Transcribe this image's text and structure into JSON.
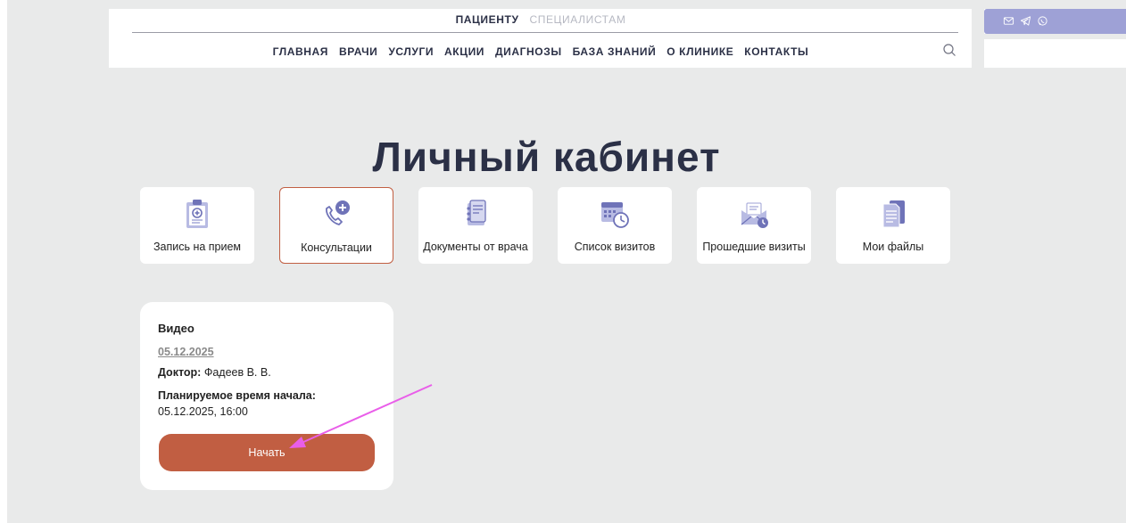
{
  "header": {
    "audience_tabs": [
      {
        "label": "ПАЦИЕНТУ",
        "active": true
      },
      {
        "label": "СПЕЦИАЛИСТАМ",
        "active": false
      }
    ],
    "nav": [
      "ГЛАВНАЯ",
      "ВРАЧИ",
      "УСЛУГИ",
      "АКЦИИ",
      "ДИАГНОЗЫ",
      "БАЗА ЗНАНИЙ",
      "О КЛИНИКЕ",
      "КОНТАКТЫ"
    ],
    "search_icon": "search-icon"
  },
  "contact_bar": {
    "icons": [
      "mail-icon",
      "telegram-icon",
      "whatsapp-icon"
    ],
    "color": "#9ea1d6"
  },
  "page": {
    "title": "Личный кабинет"
  },
  "tiles": [
    {
      "label": "Запись на прием",
      "icon": "clipboard-plus-icon",
      "active": false
    },
    {
      "label": "Консультации",
      "icon": "phone-plus-icon",
      "active": true
    },
    {
      "label": "Документы от врача",
      "icon": "documents-icon",
      "active": false
    },
    {
      "label": "Список визитов",
      "icon": "calendar-clock-icon",
      "active": false
    },
    {
      "label": "Прошедшие визиты",
      "icon": "envelope-clock-icon",
      "active": false
    },
    {
      "label": "Мои файлы",
      "icon": "files-icon",
      "active": false
    }
  ],
  "consultation": {
    "type": "Видео",
    "date": "05.12.2025",
    "doctor_label": "Доктор:",
    "doctor_name": "Фадеев В. В.",
    "start_label": "Планируемое время начала:",
    "start_value": "05.12.2025, 16:00",
    "button_label": "Начать"
  },
  "colors": {
    "accent": "#c15e42",
    "icon_primary": "#9ea1d6",
    "text_dark": "#2b3046",
    "background": "#e9eaea",
    "annotation_arrow": "#e95ee9"
  }
}
